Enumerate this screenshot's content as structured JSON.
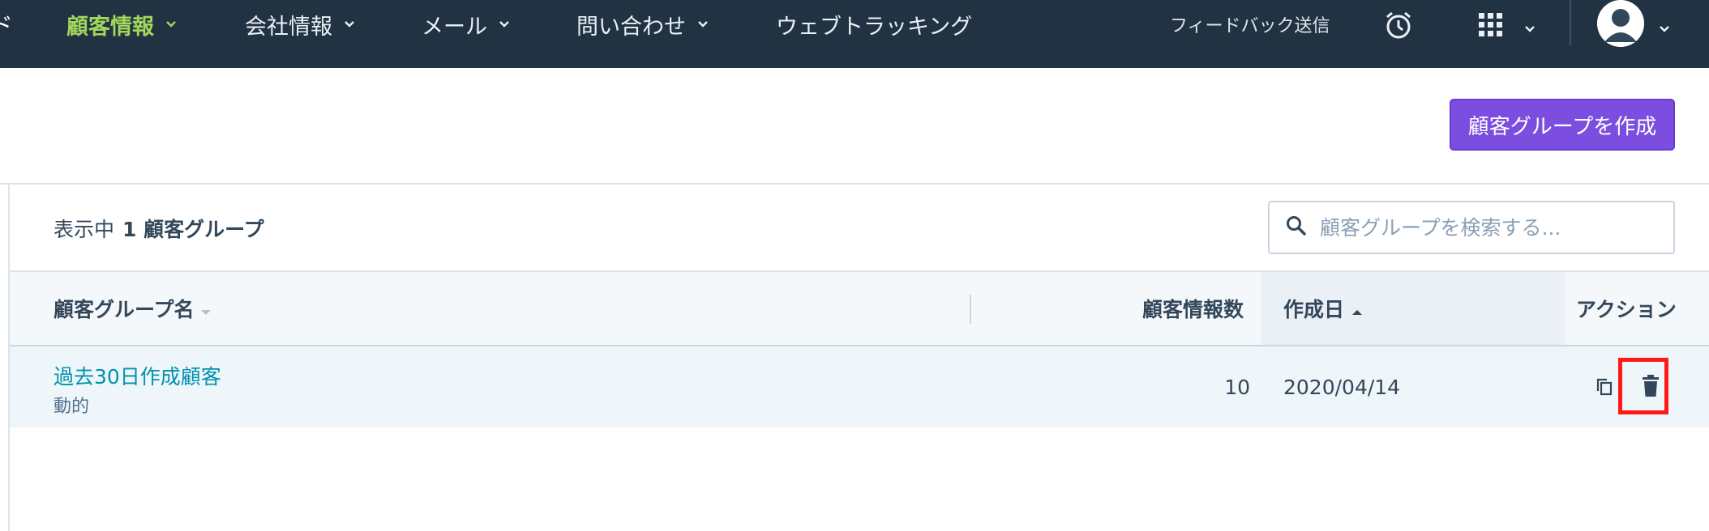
{
  "nav": {
    "clipped_label": "ド",
    "items": [
      {
        "label": "顧客情報",
        "active": true
      },
      {
        "label": "会社情報"
      },
      {
        "label": "メール"
      },
      {
        "label": "問い合わせ"
      },
      {
        "label": "ウェブトラッキング"
      }
    ],
    "feedback": "フィードバック送信",
    "icons": [
      "alarm-clock-icon",
      "apps-grid-icon",
      "user-avatar-icon"
    ]
  },
  "header": {
    "create_button": "顧客グループを作成"
  },
  "toolbar": {
    "showing_label": "表示中",
    "showing_count": "1 顧客グループ",
    "search_placeholder": "顧客グループを検索する..."
  },
  "table": {
    "columns": {
      "name": "顧客グループ名",
      "count": "顧客情報数",
      "created": "作成日",
      "actions": "アクション"
    },
    "rows": [
      {
        "name": "過去30日作成顧客",
        "type": "動的",
        "count": "10",
        "created": "2020/04/14"
      }
    ]
  },
  "colors": {
    "nav_bg": "#213343",
    "nav_active": "#a3d65c",
    "primary_button": "#7c4ee0",
    "link": "#0091ae",
    "highlight_box": "#ff1a1a"
  }
}
